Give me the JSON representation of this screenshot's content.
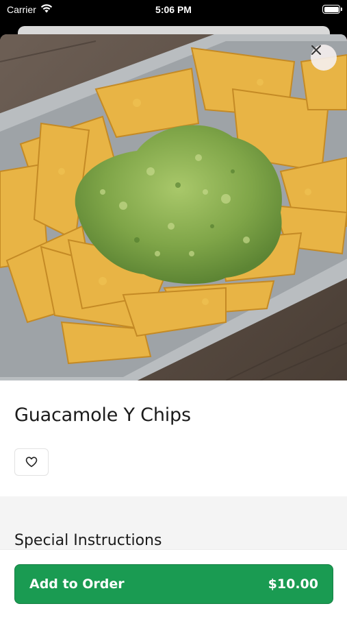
{
  "status_bar": {
    "carrier": "Carrier",
    "time": "5:06 PM"
  },
  "item": {
    "name": "Guacamole Y Chips",
    "image_alt": "guacamole and tortilla chips in a metal tray"
  },
  "instructions": {
    "title": "Special Instructions"
  },
  "order_button": {
    "label": "Add to Order",
    "price": "$10.00"
  },
  "colors": {
    "accent": "#1a9b52",
    "background": "#ffffff",
    "section": "#f4f4f4"
  },
  "icons": {
    "close": "close-icon",
    "favorite": "heart-icon",
    "wifi": "wifi-icon",
    "battery": "battery-icon"
  }
}
